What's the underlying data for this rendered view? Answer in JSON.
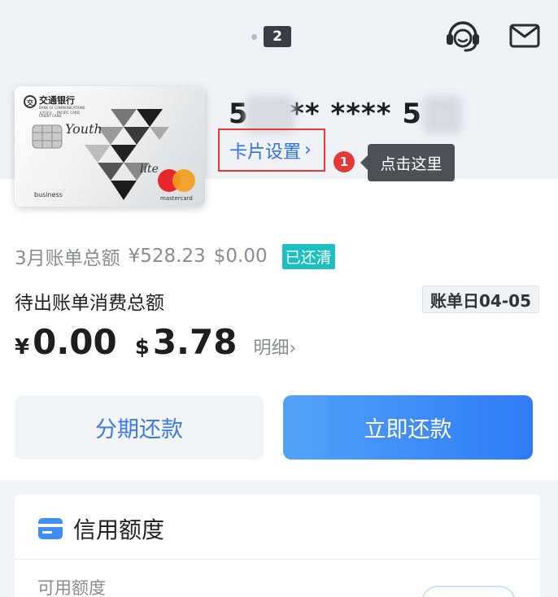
{
  "header": {
    "page_number": "2",
    "support_icon": "headset-icon",
    "mail_icon": "mail-icon"
  },
  "card": {
    "bank_name": "交通银行",
    "bank_sub": "BANK OF COMMUNICATIONS",
    "type_label": "CREDIT CARD",
    "partner": "太平洋卡",
    "partner_en": "PACIFIC CARD",
    "series_word_1": "Youth",
    "series_word_2": "lite",
    "card_class": "business",
    "network": "mastercard",
    "number_display": "5     **** ****  5    5",
    "settings_label": "卡片设置",
    "settings_chevron": "›"
  },
  "guide": {
    "step": "1",
    "tooltip": "点击这里"
  },
  "bill": {
    "summary_label": "3月账单总额",
    "cny_amount": "¥528.23",
    "usd_amount": "$0.00",
    "status": "已还清",
    "pending_label": "待出账单消费总额",
    "bill_day": "账单日04-05",
    "cny_symbol": "¥",
    "cny_pending": "0.00",
    "usd_symbol": "$",
    "usd_pending": "3.78",
    "detail_link": "明细›"
  },
  "actions": {
    "installment": "分期还款",
    "pay_now": "立即还款"
  },
  "credit": {
    "title": "信用额度",
    "available_label": "可用额度"
  },
  "colors": {
    "accent_blue": "#2f7bf6",
    "highlight_red": "#e53935",
    "paid_teal": "#1cc0c3"
  }
}
